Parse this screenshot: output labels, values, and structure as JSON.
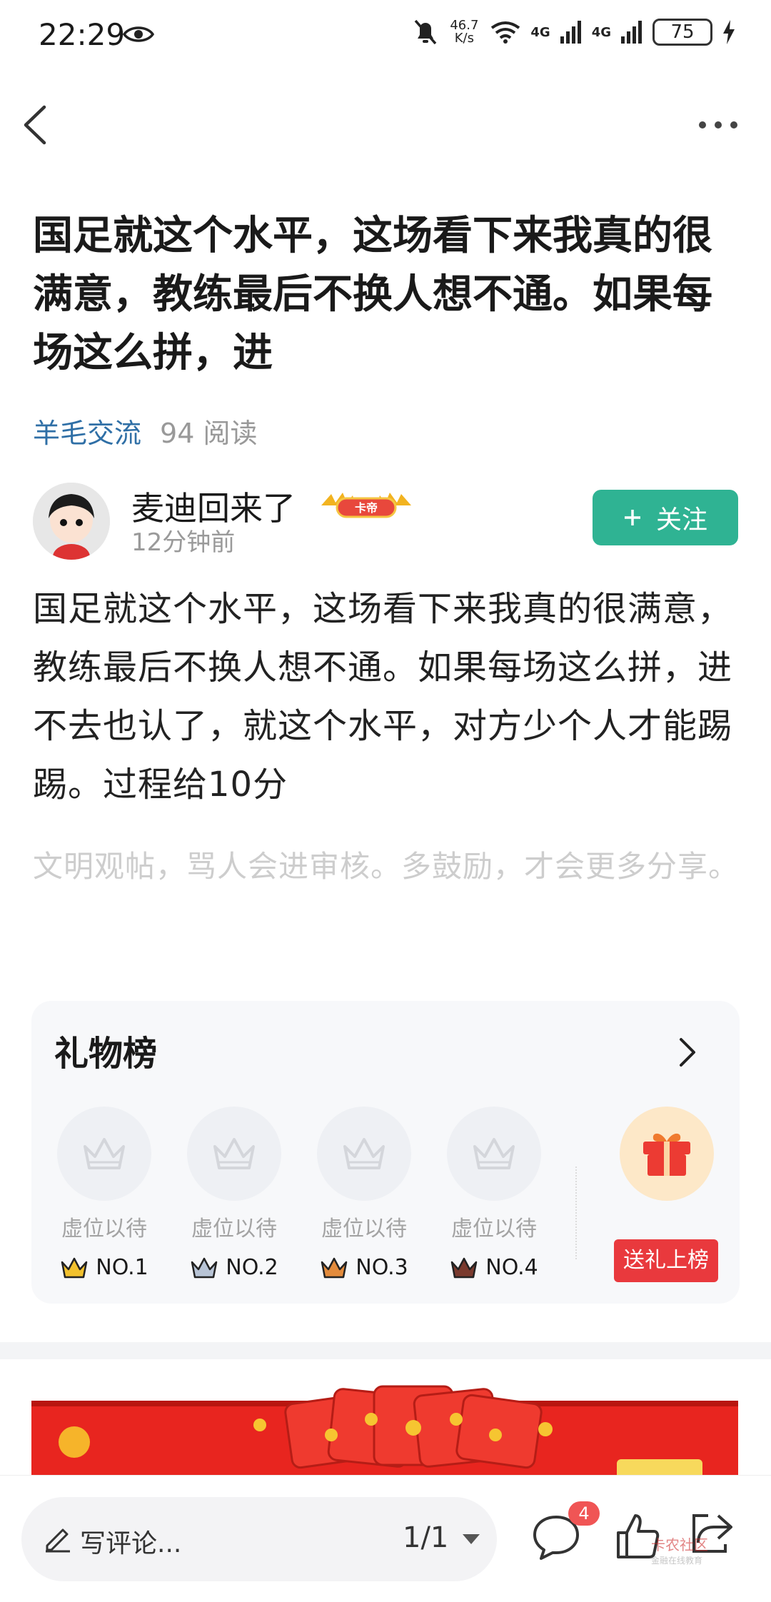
{
  "status_bar": {
    "time": "22:29",
    "speed_value": "46.7",
    "speed_unit": "K/s",
    "network_1": "4G",
    "network_2": "4G",
    "battery": "75",
    "icons": [
      "eye-icon",
      "mute-bell-icon",
      "wifi-icon",
      "signal-icon",
      "charging-icon"
    ]
  },
  "nav": {
    "icons": [
      "back-arrow-icon",
      "more-dots-icon"
    ]
  },
  "post": {
    "title": "国足就这个水平，这场看下来我真的很满意，教练最后不换人想不通。如果每场这么拼，进",
    "category": "羊毛交流",
    "reads": "94 阅读",
    "author": {
      "name": "麦迪回来了",
      "badge": "卡帝",
      "time": "12分钟前",
      "follow_label": "关注"
    },
    "body": "国足就这个水平，这场看下来我真的很满意，教练最后不换人想不通。如果每场这么拼，进不去也认了，就这个水平，对方少个人才能踢踢。过程给10分",
    "note": "文明观帖，骂人会进审核。多鼓励，才会更多分享。"
  },
  "gift_board": {
    "title": "礼物榜",
    "slots": [
      {
        "label": "虚位以待",
        "rank": "NO.1",
        "color": "#f2c12e"
      },
      {
        "label": "虚位以待",
        "rank": "NO.2",
        "color": "#b8c4d6"
      },
      {
        "label": "虚位以待",
        "rank": "NO.3",
        "color": "#e38b3c"
      },
      {
        "label": "虚位以待",
        "rank": "NO.4",
        "color": "#7a3a2e"
      }
    ],
    "send_label": "送礼上榜"
  },
  "bottom_bar": {
    "comment_placeholder": "写评论...",
    "page": "1/1",
    "comment_count": "4",
    "watermark": "卡农社区",
    "watermark_sub": "金融在线教育"
  },
  "colors": {
    "accent_green": "#2fb393",
    "category_blue": "#2f6fa6",
    "red": "#e9393d"
  }
}
